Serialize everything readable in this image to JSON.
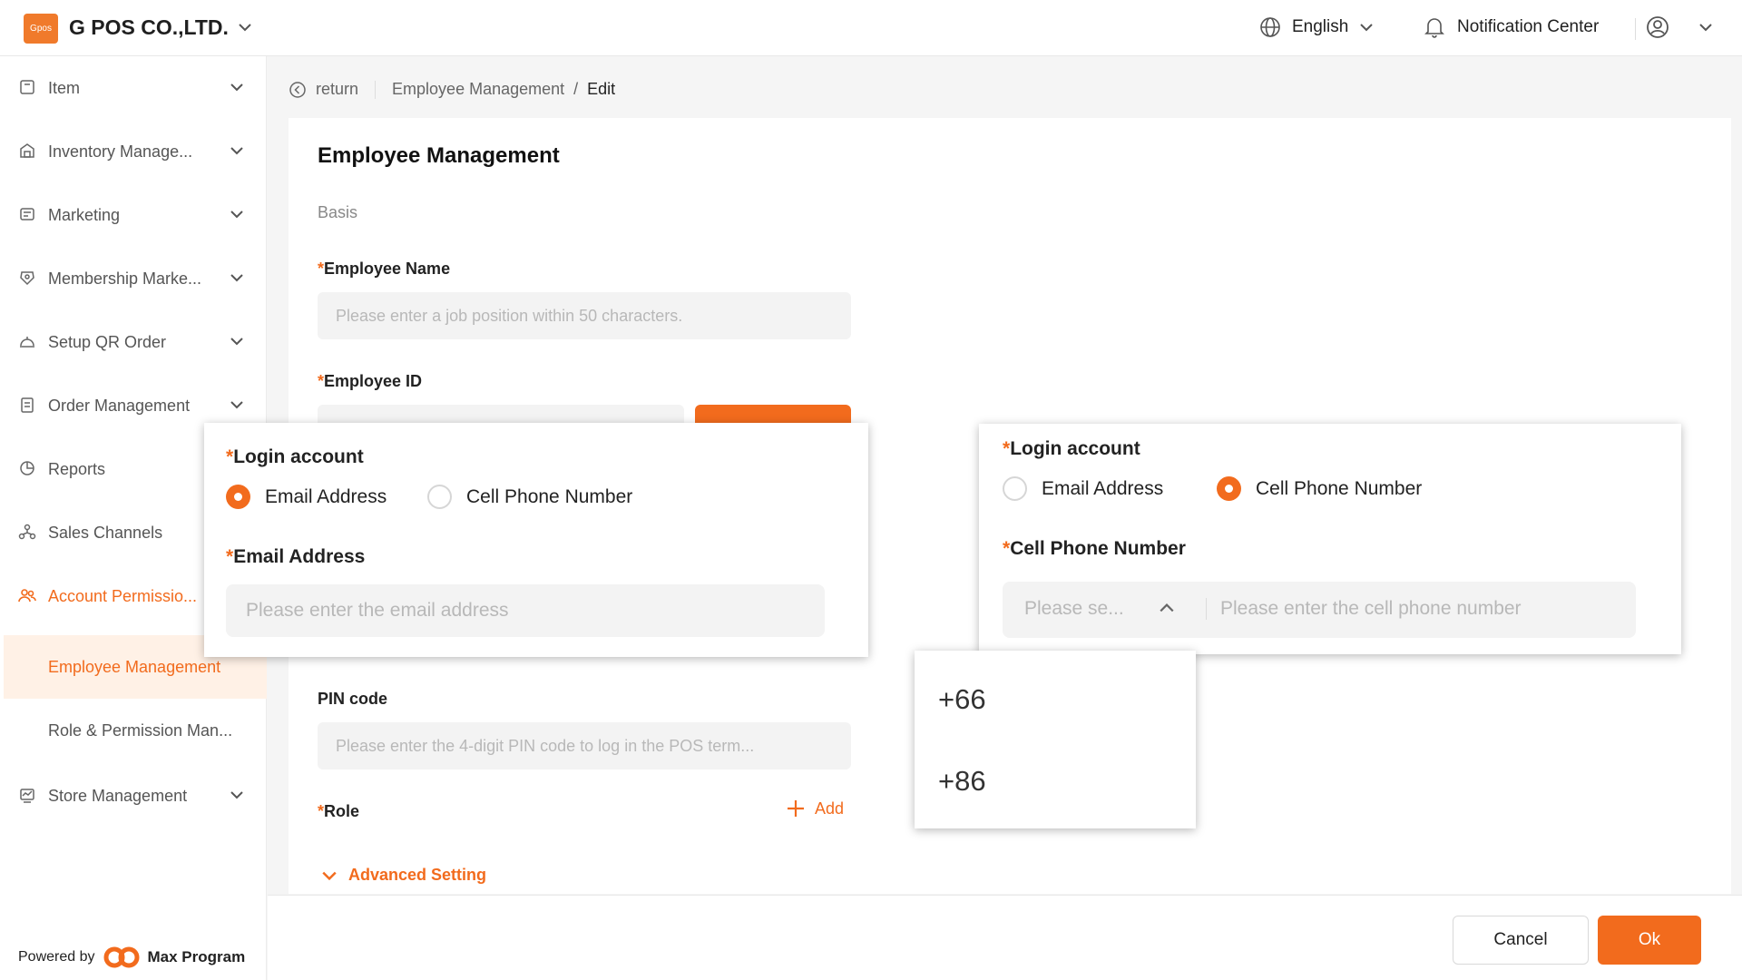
{
  "header": {
    "logo_text": "Gpos",
    "company": "G POS CO.,LTD.",
    "language": "English",
    "notification": "Notification Center"
  },
  "sidebar": {
    "items": [
      {
        "label": "Item",
        "icon": "item-icon"
      },
      {
        "label": "Inventory Manage...",
        "icon": "inventory-icon"
      },
      {
        "label": "Marketing",
        "icon": "marketing-icon"
      },
      {
        "label": "Membership Marke...",
        "icon": "membership-icon"
      },
      {
        "label": "Setup QR Order",
        "icon": "qr-order-icon"
      },
      {
        "label": "Order Management",
        "icon": "order-icon"
      },
      {
        "label": "Reports",
        "icon": "reports-icon"
      },
      {
        "label": "Sales Channels",
        "icon": "sales-channels-icon"
      },
      {
        "label": "Account Permissio...",
        "icon": "account-permission-icon"
      }
    ],
    "subitems": [
      {
        "label": "Employee Management",
        "active": true
      },
      {
        "label": "Role & Permission Man..."
      }
    ],
    "store": {
      "label": "Store Management",
      "icon": "store-icon"
    },
    "powered_by": "Powered by",
    "powered_brand": "Max Program"
  },
  "breadcrumb": {
    "return": "return",
    "parent": "Employee Management",
    "separator": "/",
    "current": "Edit"
  },
  "form": {
    "title": "Employee Management",
    "section": "Basis",
    "required_mark": "*",
    "employee_name_label": "Employee Name",
    "employee_name_placeholder": "Please enter a job position within 50 characters.",
    "employee_id_label": "Employee ID",
    "pin_label": "PIN code",
    "pin_placeholder": "Please enter the 4-digit PIN code to log in the POS term...",
    "role_label": "Role",
    "role_add": "Add",
    "advanced_setting": "Advanced Setting"
  },
  "footer": {
    "cancel": "Cancel",
    "ok": "Ok"
  },
  "panel_email": {
    "login_label": "Login account",
    "option_email": "Email Address",
    "option_phone": "Cell Phone Number",
    "selected": "email",
    "field_label": "Email Address",
    "placeholder": "Please enter the email address"
  },
  "panel_phone": {
    "login_label": "Login account",
    "option_email": "Email Address",
    "option_phone": "Cell Phone Number",
    "selected": "phone",
    "field_label": "Cell Phone Number",
    "prefix_placeholder": "Please se...",
    "placeholder": "Please enter the cell phone number"
  },
  "dropdown": {
    "options": [
      "+66",
      "+86"
    ]
  },
  "colors": {
    "accent": "#f26b1d",
    "active_bg": "#fff1e6"
  }
}
